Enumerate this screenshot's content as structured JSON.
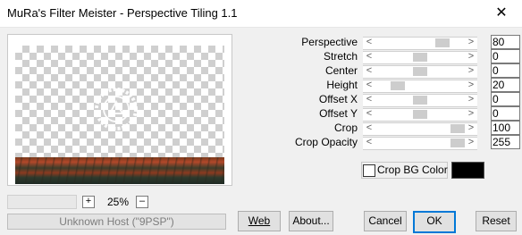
{
  "window": {
    "title": "MuRa's Filter Meister - Perspective Tiling 1.1",
    "close_label": "✕"
  },
  "preview": {
    "zoom": "25%",
    "plus": "+",
    "minus": "–",
    "status": "Unknown Host (\"9PSP\")"
  },
  "params": [
    {
      "label": "Perspective",
      "value": "80",
      "fraction": 0.8
    },
    {
      "label": "Stretch",
      "value": "0",
      "fraction": 0.5
    },
    {
      "label": "Center",
      "value": "0",
      "fraction": 0.5
    },
    {
      "label": "Height",
      "value": "20",
      "fraction": 0.2
    },
    {
      "label": "Offset X",
      "value": "0",
      "fraction": 0.5
    },
    {
      "label": "Offset Y",
      "value": "0",
      "fraction": 0.5
    },
    {
      "label": "Crop",
      "value": "100",
      "fraction": 1.0
    },
    {
      "label": "Crop Opacity",
      "value": "255",
      "fraction": 1.0
    }
  ],
  "crop_bg": {
    "label": "Crop BG Color",
    "checked": false,
    "color": "#000000"
  },
  "buttons": {
    "web": "Web",
    "about": "About...",
    "cancel": "Cancel",
    "ok": "OK",
    "reset": "Reset"
  }
}
